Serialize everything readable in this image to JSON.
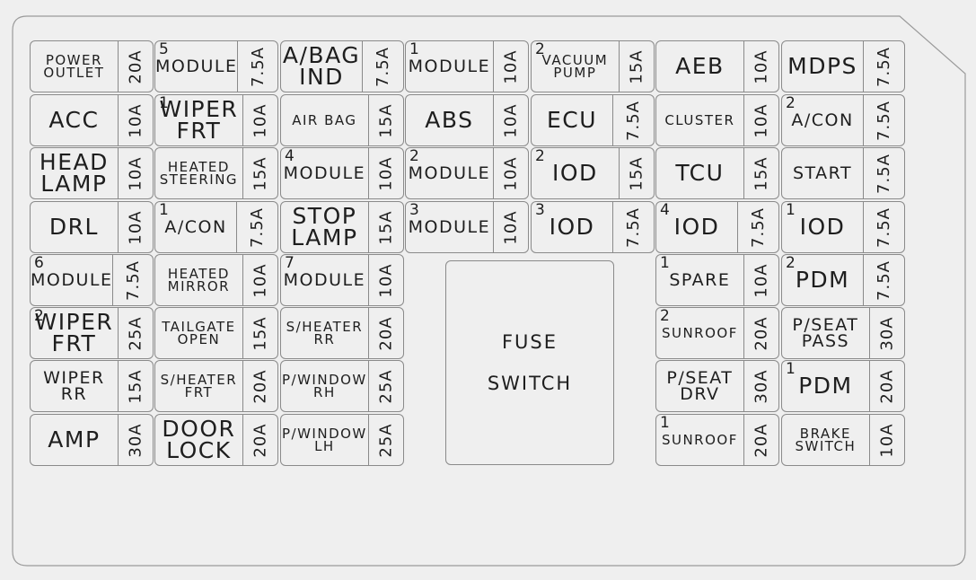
{
  "fuse_switch": {
    "line1": "FUSE",
    "line2": "SWITCH"
  },
  "columns": [
    [
      {
        "label": "POWER\nOUTLET",
        "num": "",
        "amp": "20A"
      },
      {
        "label": "ACC",
        "num": "",
        "amp": "10A"
      },
      {
        "label": "HEAD\nLAMP",
        "num": "",
        "amp": "10A"
      },
      {
        "label": "DRL",
        "num": "",
        "amp": "10A"
      },
      {
        "label": "MODULE",
        "num": "6",
        "amp": "7.5A"
      },
      {
        "label": "WIPER\nFRT",
        "num": "2",
        "amp": "25A"
      },
      {
        "label": "WIPER\nRR",
        "num": "",
        "amp": "15A"
      },
      {
        "label": "AMP",
        "num": "",
        "amp": "30A"
      }
    ],
    [
      {
        "label": "MODULE",
        "num": "5",
        "amp": "7.5A"
      },
      {
        "label": "WIPER\nFRT",
        "num": "1",
        "amp": "10A"
      },
      {
        "label": "HEATED\nSTEERING",
        "num": "",
        "amp": "15A"
      },
      {
        "label": "A/CON",
        "num": "1",
        "amp": "7.5A"
      },
      {
        "label": "HEATED\nMIRROR",
        "num": "",
        "amp": "10A"
      },
      {
        "label": "TAILGATE\nOPEN",
        "num": "",
        "amp": "15A"
      },
      {
        "label": "S/HEATER\nFRT",
        "num": "",
        "amp": "20A"
      },
      {
        "label": "DOOR\nLOCK",
        "num": "",
        "amp": "20A"
      }
    ],
    [
      {
        "label": "A/BAG\nIND",
        "num": "",
        "amp": "7.5A"
      },
      {
        "label": "AIR BAG",
        "num": "",
        "amp": "15A"
      },
      {
        "label": "MODULE",
        "num": "4",
        "amp": "10A"
      },
      {
        "label": "STOP\nLAMP",
        "num": "",
        "amp": "15A"
      },
      {
        "label": "MODULE",
        "num": "7",
        "amp": "10A"
      },
      {
        "label": "S/HEATER\nRR",
        "num": "",
        "amp": "20A"
      },
      {
        "label": "P/WINDOW\nRH",
        "num": "",
        "amp": "25A"
      },
      {
        "label": "P/WINDOW\nLH",
        "num": "",
        "amp": "25A"
      }
    ],
    [
      {
        "label": "MODULE",
        "num": "1",
        "amp": "10A"
      },
      {
        "label": "ABS",
        "num": "",
        "amp": "10A"
      },
      {
        "label": "MODULE",
        "num": "2",
        "amp": "10A"
      },
      {
        "label": "MODULE",
        "num": "3",
        "amp": "10A"
      }
    ],
    [
      {
        "label": "VACUUM\nPUMP",
        "num": "2",
        "amp": "15A"
      },
      {
        "label": "ECU",
        "num": "",
        "amp": "7.5A"
      },
      {
        "label": "IOD",
        "num": "2",
        "amp": "15A"
      },
      {
        "label": "IOD",
        "num": "3",
        "amp": "7.5A"
      }
    ],
    [
      {
        "label": "AEB",
        "num": "",
        "amp": "10A"
      },
      {
        "label": "CLUSTER",
        "num": "",
        "amp": "10A"
      },
      {
        "label": "TCU",
        "num": "",
        "amp": "15A"
      },
      {
        "label": "IOD",
        "num": "4",
        "amp": "7.5A"
      },
      {
        "label": "SPARE",
        "num": "1",
        "amp": "10A"
      },
      {
        "label": "SUNROOF",
        "num": "2",
        "amp": "20A"
      },
      {
        "label": "P/SEAT\nDRV",
        "num": "",
        "amp": "30A"
      },
      {
        "label": "SUNROOF",
        "num": "1",
        "amp": "20A"
      }
    ],
    [
      {
        "label": "MDPS",
        "num": "",
        "amp": "7.5A"
      },
      {
        "label": "A/CON",
        "num": "2",
        "amp": "7.5A"
      },
      {
        "label": "START",
        "num": "",
        "amp": "7.5A"
      },
      {
        "label": "IOD",
        "num": "1",
        "amp": "7.5A"
      },
      {
        "label": "PDM",
        "num": "2",
        "amp": "7.5A"
      },
      {
        "label": "P/SEAT\nPASS",
        "num": "",
        "amp": "30A"
      },
      {
        "label": "PDM",
        "num": "1",
        "amp": "20A"
      },
      {
        "label": "BRAKE\nSWITCH",
        "num": "",
        "amp": "10A"
      }
    ]
  ]
}
